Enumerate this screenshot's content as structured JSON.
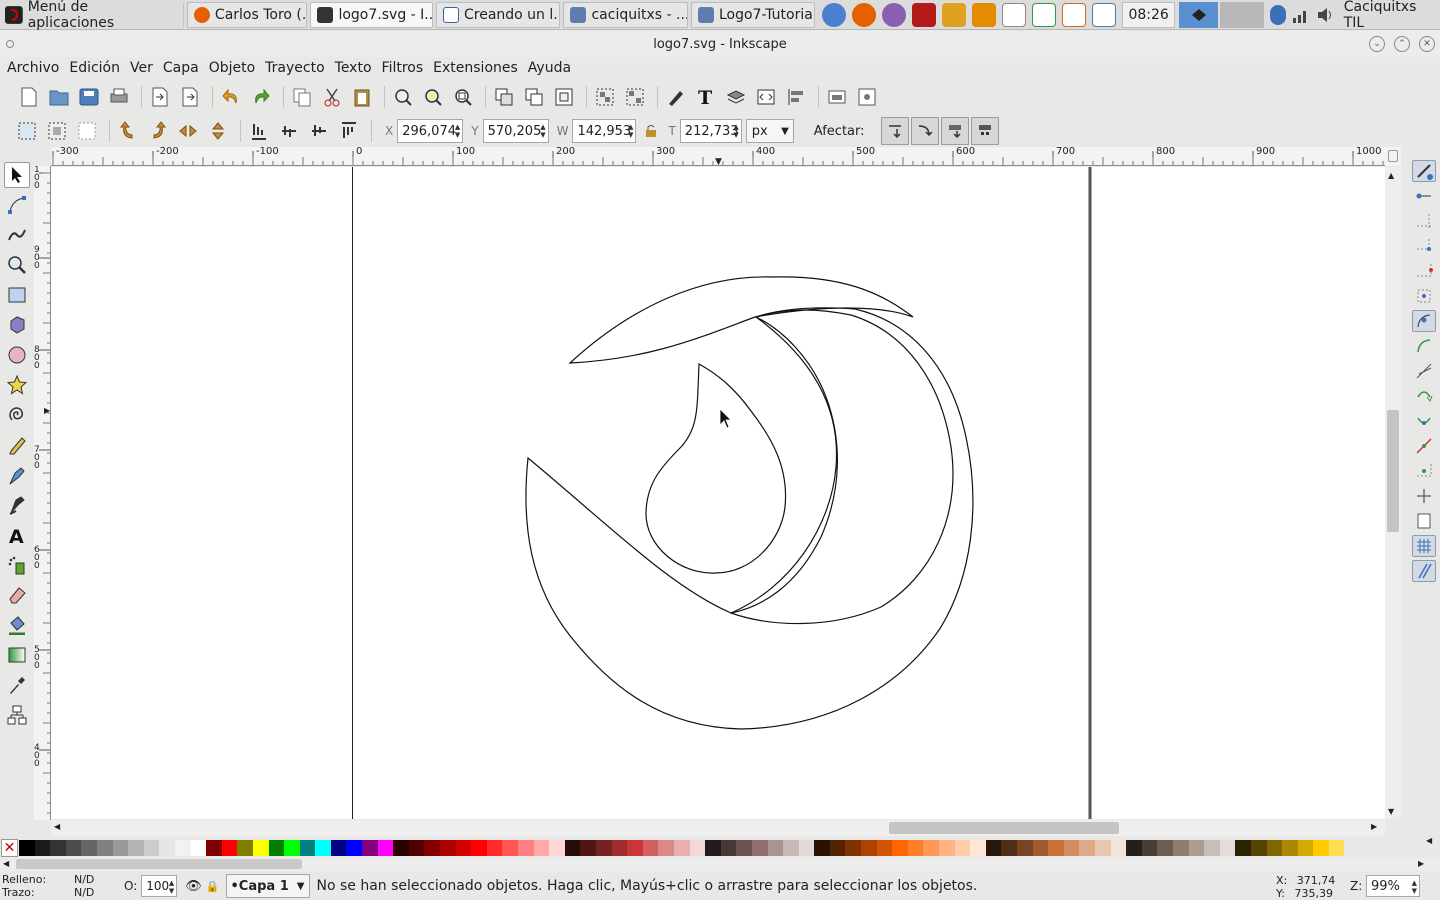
{
  "taskbar": {
    "app_menu_label": "Menú de aplicaciones",
    "tasks": [
      {
        "label": "Carlos Toro (...",
        "icon": "firefox-icon",
        "color": "#e66000"
      },
      {
        "label": "logo7.svg - I...",
        "icon": "inkscape-icon",
        "color": "#333333"
      },
      {
        "label": "Creando un l...",
        "icon": "document-icon",
        "color": "#3465a4"
      },
      {
        "label": "caciquitxs - ...",
        "icon": "folder-icon",
        "color": "#5c7fb0"
      },
      {
        "label": "Logo7-Tutoria...",
        "icon": "folder-icon",
        "color": "#5c7fb0"
      }
    ],
    "launchers": [
      {
        "name": "chromium-icon",
        "color": "#4a7fd1"
      },
      {
        "name": "firefox-icon",
        "color": "#e66000"
      },
      {
        "name": "pidgin-icon",
        "color": "#8a5fb2"
      },
      {
        "name": "terminal-icon",
        "color": "#b31b1b"
      },
      {
        "name": "lightning-icon",
        "color": "#e0a020"
      },
      {
        "name": "edit-icon",
        "color": "#e58b00"
      },
      {
        "name": "blank-document-icon",
        "color": "#ffffff"
      },
      {
        "name": "spreadsheet-icon",
        "color": "#2f9a3b"
      },
      {
        "name": "presentation-icon",
        "color": "#d06d1f"
      },
      {
        "name": "drawing-icon",
        "color": "#3e7fb9"
      }
    ],
    "clock": "08:26",
    "user": "Caciquitxs TIL"
  },
  "window": {
    "title": "logo7.svg - Inkscape"
  },
  "menubar": {
    "items": [
      "Archivo",
      "Edición",
      "Ver",
      "Capa",
      "Objeto",
      "Trayecto",
      "Texto",
      "Filtros",
      "Extensiones",
      "Ayuda"
    ]
  },
  "controls": {
    "x_label": "X",
    "x_value": "296,074",
    "y_label": "Y",
    "y_value": "570,205",
    "w_label": "W",
    "w_value": "142,953",
    "h_label": "T",
    "h_value": "212,733",
    "unit": "px",
    "affect_label": "Afectar:"
  },
  "rulers": {
    "h_ticks": [
      "-300",
      "-200",
      "-100",
      "0",
      "100",
      "200",
      "300",
      "400",
      "500",
      "600",
      "700",
      "800",
      "900",
      "1000"
    ],
    "v_ticks": [
      "100",
      "900",
      "800",
      "700",
      "600",
      "500",
      "400"
    ]
  },
  "palette": {
    "colors": [
      "#000000",
      "#1a1a1a",
      "#333333",
      "#4d4d4d",
      "#666666",
      "#808080",
      "#999999",
      "#b3b3b3",
      "#cccccc",
      "#e6e6e6",
      "#f2f2f2",
      "#ffffff",
      "#800000",
      "#ff0000",
      "#808000",
      "#ffff00",
      "#008000",
      "#00ff00",
      "#008080",
      "#00ffff",
      "#000080",
      "#0000ff",
      "#800080",
      "#ff00ff",
      "#2b0000",
      "#550000",
      "#800000",
      "#aa0000",
      "#d40000",
      "#ff0000",
      "#ff2a2a",
      "#ff5555",
      "#ff8080",
      "#ffaaaa",
      "#ffd5d5",
      "#280b0b",
      "#501616",
      "#782121",
      "#a02c2c",
      "#c83737",
      "#d35f5f",
      "#de8787",
      "#e9afaf",
      "#f4d7d7",
      "#241c1c",
      "#483737",
      "#6c5353",
      "#916f6f",
      "#ac9393",
      "#c8b7b7",
      "#e3dbdb",
      "#2b1100",
      "#552200",
      "#803300",
      "#aa4400",
      "#d45500",
      "#ff6600",
      "#ff7f2a",
      "#ff9955",
      "#ffb380",
      "#ffccaa",
      "#ffe6d5",
      "#28170b",
      "#502d16",
      "#784421",
      "#a05a2c",
      "#c87137",
      "#d38d5f",
      "#deaa87",
      "#e9c6af",
      "#f4e3d7",
      "#241f1c",
      "#483e37",
      "#6c5d53",
      "#917c6f",
      "#ac9d93",
      "#c8beb7",
      "#e3dedb",
      "#2b2200",
      "#554400",
      "#806600",
      "#aa8800",
      "#d4aa00",
      "#ffcc00",
      "#ffdd55"
    ]
  },
  "status": {
    "fill_label": "Relleno:",
    "fill_value": "N/D",
    "stroke_label": "Trazo:",
    "stroke_value": "N/D",
    "opacity_label": "O:",
    "opacity_value": "100",
    "layer": "•Capa 1",
    "message": "No se han seleccionado objetos. Haga clic, Mayús+clic o arrastre para seleccionar los objetos.",
    "coord_x_label": "X:",
    "coord_x": "371,74",
    "coord_y_label": "Y:",
    "coord_y": "735,39",
    "zoom_label": "Z:",
    "zoom_value": "99%"
  }
}
